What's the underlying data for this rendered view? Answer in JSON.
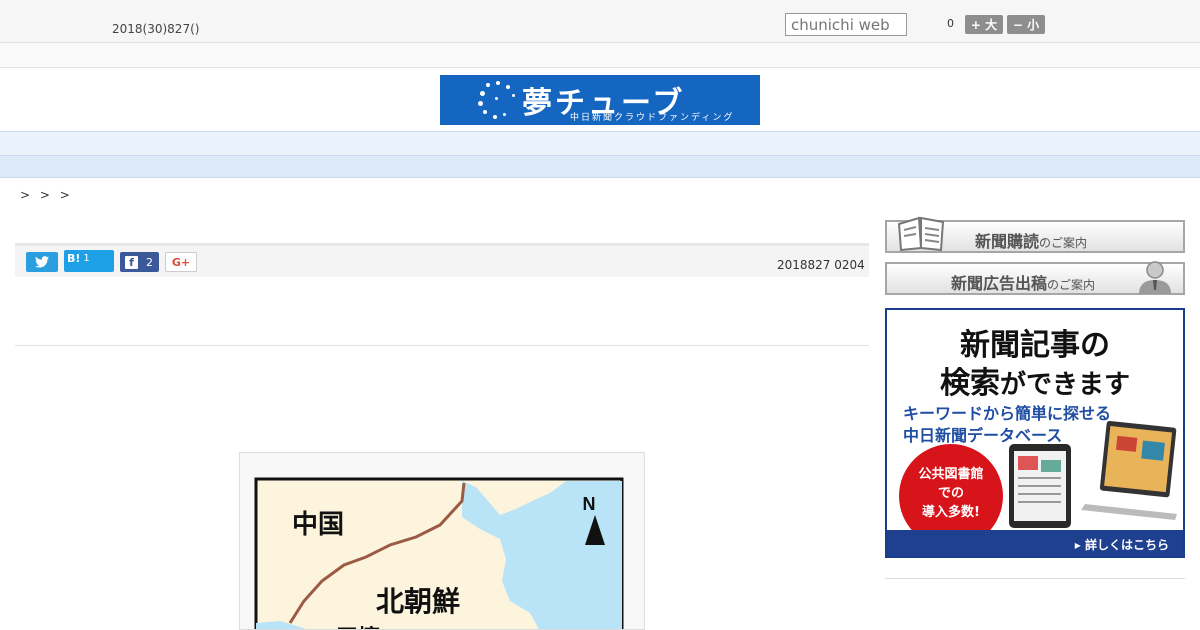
{
  "header": {
    "date": "2018(30)827()",
    "search_placeholder": "chunichi web",
    "font_size_value": "0",
    "font_larger_label": "+ 大",
    "font_smaller_label": "− 小"
  },
  "logo": {
    "title": "夢チューブ",
    "subtitle": "中日新聞クラウドファンディング"
  },
  "nav": {
    "items": [
      "",
      "",
      "",
      "",
      "",
      "",
      "",
      "",
      ""
    ]
  },
  "breadcrumb": {
    "text": "> > >"
  },
  "share": {
    "hatena_label": "B!",
    "hatena_count": "1",
    "facebook_count": "2",
    "gplus_label": "G+",
    "publish_date": "2018827 0204"
  },
  "map": {
    "label_china": "中国",
    "label_north_korea": "北朝鮮",
    "label_city": "平壌",
    "north_label": "N"
  },
  "sidebar": {
    "subscribe_main": "新聞購読",
    "subscribe_sub": "のご案内",
    "ad_main": "新聞広告出稿",
    "ad_sub": "のご案内",
    "banner_line1": "新聞記事の",
    "banner_line2_bold": "検索",
    "banner_line2_rest": "ができます",
    "banner_line3": "キーワードから簡単に探せる",
    "banner_line4": "中日新聞データベース",
    "banner_badge_1": "公共図書館",
    "banner_badge_2": "での",
    "banner_badge_3": "導入多数!",
    "banner_link": "▸ 詳しくはこちら"
  },
  "colors": {
    "logo_blue": "#1566c0",
    "nav_bg": "#eaf2fb",
    "banner_red": "#d8141b",
    "banner_navy": "#1f3f8f",
    "twitter": "#2b9ee0",
    "hatena": "#1ea0e6",
    "facebook": "#3b5998"
  }
}
